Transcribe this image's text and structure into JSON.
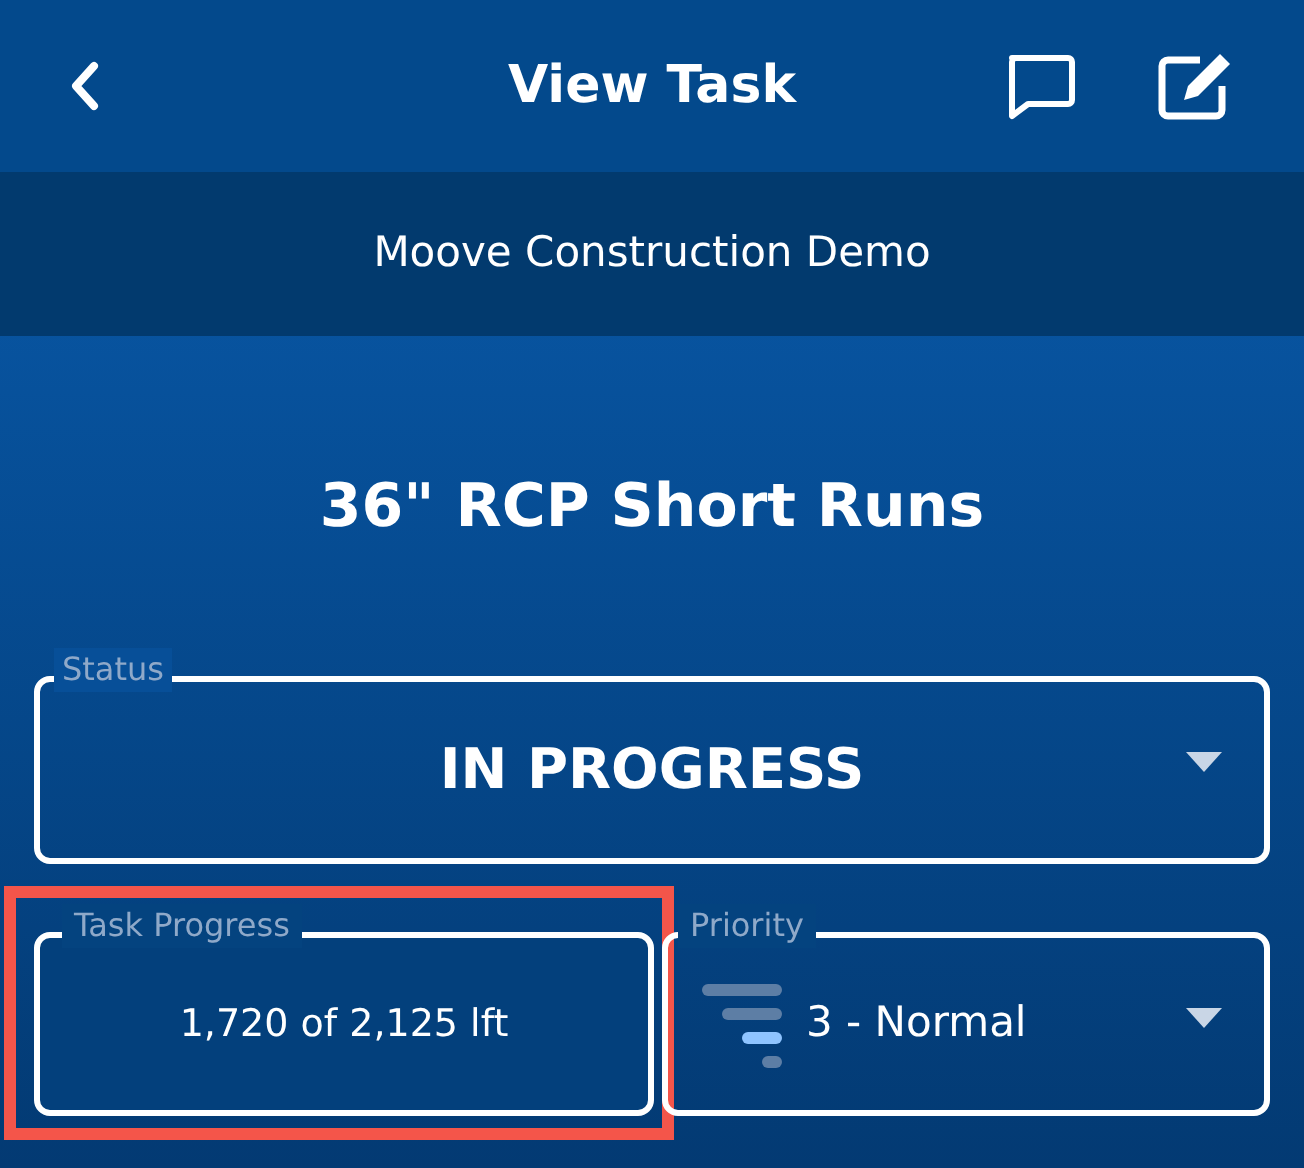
{
  "header": {
    "title": "View Task"
  },
  "project": {
    "name": "Moove Construction Demo"
  },
  "task": {
    "name": "36\" RCP Short Runs"
  },
  "status": {
    "label": "Status",
    "value": "IN PROGRESS"
  },
  "task_progress": {
    "label": "Task Progress",
    "value": "1,720 of 2,125 lft",
    "highlighted": true
  },
  "priority": {
    "label": "Priority",
    "value": "3 - Normal"
  }
}
